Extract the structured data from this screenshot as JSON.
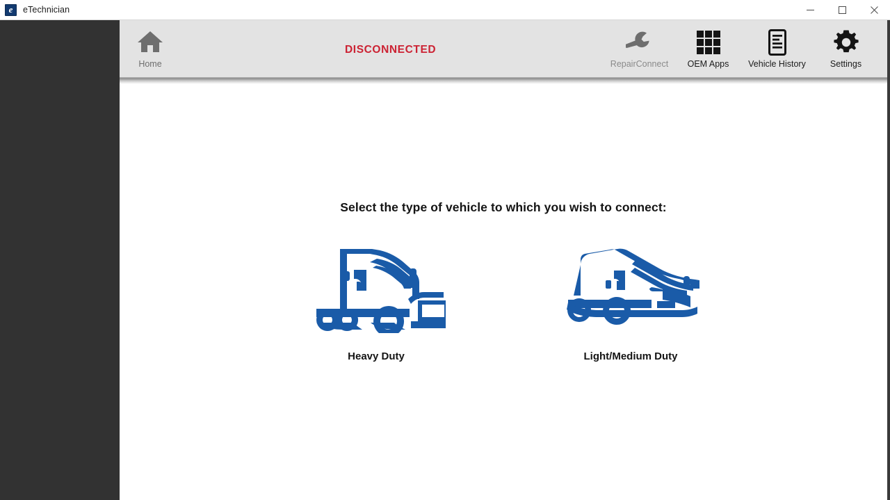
{
  "window": {
    "title": "eTechnician",
    "app_icon": "etechnician-e-icon",
    "icon_letter": "e",
    "controls": {
      "minimize": "minimize-icon",
      "maximize": "maximize-icon",
      "close": "close-icon"
    }
  },
  "toolbar": {
    "background_color": "#e3e3e3",
    "home": {
      "label": "Home",
      "icon": "home-icon",
      "color": "#6e6e6e"
    },
    "status": {
      "text": "DISCONNECTED",
      "color": "#cc2233"
    },
    "items": [
      {
        "label": "RepairConnect",
        "icon": "wrench-icon",
        "enabled": false,
        "color": "#8a8a8a"
      },
      {
        "label": "OEM Apps",
        "icon": "grid-3x3-icon",
        "enabled": true,
        "color": "#1b1b1b"
      },
      {
        "label": "Vehicle History",
        "icon": "document-lines-icon",
        "enabled": true,
        "color": "#1b1b1b"
      },
      {
        "label": "Settings",
        "icon": "gear-icon",
        "enabled": true,
        "color": "#1b1b1b"
      }
    ]
  },
  "main": {
    "prompt": "Select the type of vehicle to which you wish to connect:",
    "accent_color": "#1a5ba8",
    "choices": [
      {
        "label": "Heavy Duty",
        "icon": "semi-truck-icon"
      },
      {
        "label": "Light/Medium Duty",
        "icon": "cargo-van-icon"
      }
    ]
  },
  "chrome": {
    "left_rail_color": "#323232",
    "right_edge_color": "#3a3a3a"
  }
}
